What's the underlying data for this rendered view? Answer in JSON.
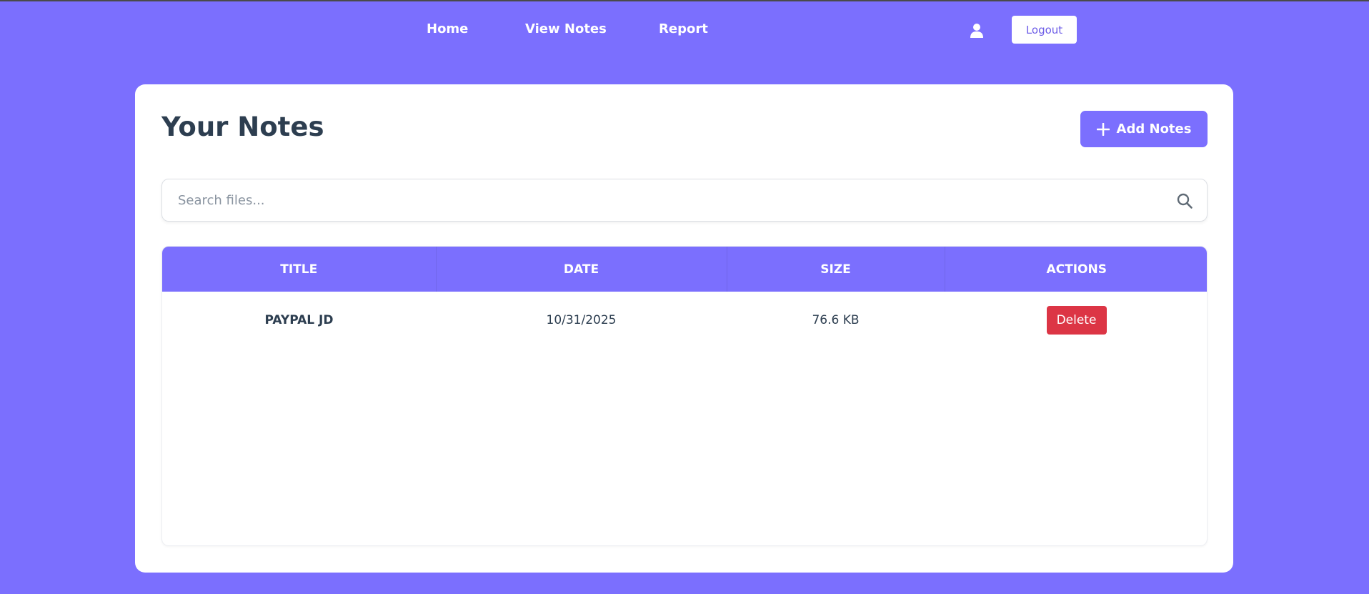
{
  "nav": {
    "home": "Home",
    "view_notes": "View Notes",
    "report": "Report",
    "logout": "Logout",
    "user_icon": "user-icon"
  },
  "colors": {
    "background": "#7b6ffe",
    "accent": "#7b6ffe",
    "danger": "#dc3545",
    "title_text": "#2d3e50"
  },
  "main": {
    "title": "Your Notes",
    "add_button": "Add Notes",
    "add_icon": "plus-icon",
    "search": {
      "placeholder": "Search files...",
      "value": "",
      "icon": "search-icon"
    },
    "table": {
      "columns": [
        "Title",
        "Date",
        "Size",
        "Actions"
      ],
      "rows": [
        {
          "title": "PAYPAL JD",
          "date": "10/31/2025",
          "size": "76.6 KB",
          "action": "Delete"
        }
      ]
    }
  }
}
